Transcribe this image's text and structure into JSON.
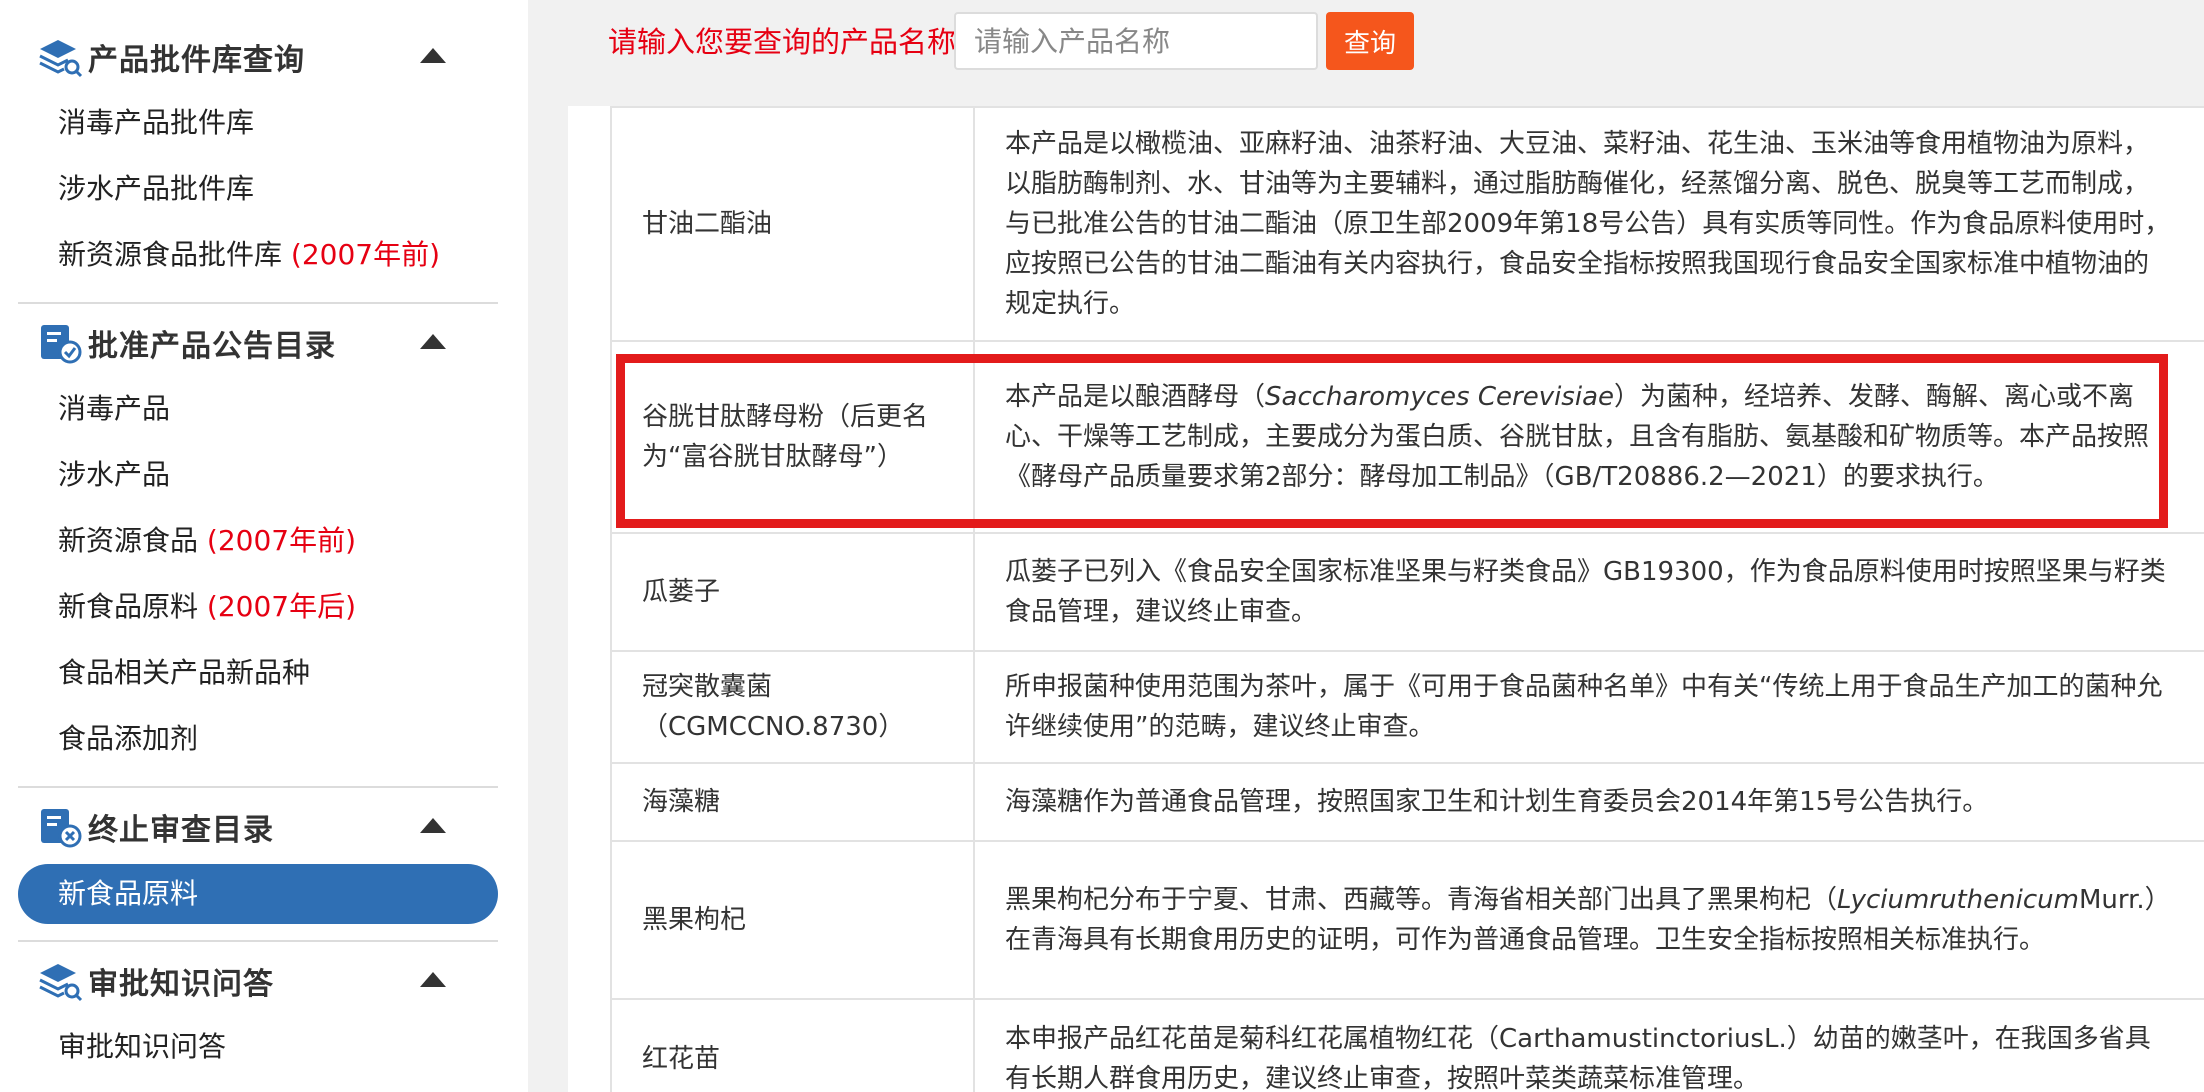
{
  "sidebar": {
    "sections": [
      {
        "title": "产品批件库查询",
        "icon": "layers-search-icon",
        "items": [
          "消毒产品批件库",
          "涉水产品批件库"
        ],
        "item_new_resource": {
          "label": "新资源食品批件库 ",
          "note": "(2007年前)"
        }
      },
      {
        "title": "批准产品公告目录",
        "icon": "approved-catalog-icon",
        "items": [
          "消毒产品",
          "涉水产品"
        ],
        "item_new_resource": {
          "label": "新资源食品 ",
          "note": "(2007年前)"
        },
        "item_new_food": {
          "label": "新食品原料 ",
          "note": "(2007年后)"
        },
        "items_more": [
          "食品相关产品新品种",
          "食品添加剂"
        ]
      },
      {
        "title": "终止审查目录",
        "icon": "terminated-catalog-icon",
        "active_item": "新食品原料"
      },
      {
        "title": "审批知识问答",
        "icon": "layers-search-icon",
        "items": [
          "审批知识问答"
        ]
      }
    ]
  },
  "search": {
    "label": "请输入您要查询的产品名称",
    "placeholder": "请输入产品名称",
    "value": "",
    "button_label": "查询"
  },
  "colors": {
    "accent_red": "#e60012",
    "active_blue": "#2f6fb4",
    "button_orange": "#f5561c",
    "highlight_box": "#e31b1b"
  },
  "table": {
    "rows": [
      {
        "name": "甘油二酯油",
        "desc": "本产品是以橄榄油、亚麻籽油、油茶籽油、大豆油、菜籽油、花生油、玉米油等食用植物油为原料，以脂肪酶制剂、水、甘油等为主要辅料，通过脂肪酶催化，经蒸馏分离、脱色、脱臭等工艺而制成，与已批准公告的甘油二酯油（原卫生部2009年第18号公告）具有实质等同性。作为食品原料使用时，应按照已公告的甘油二酯油有关内容执行，食品安全指标按照我国现行食品安全国家标准中植物油的规定执行。"
      },
      {
        "name": "谷胱甘肽酵母粉（后更名为“富谷胱甘肽酵母”）",
        "desc_before": "本产品是以酿酒酵母（",
        "desc_italic": "Saccharomyces Cerevisiae",
        "desc_after": "）为菌种，经培养、发酵、酶解、离心或不离心、干燥等工艺制成，主要成分为蛋白质、谷胱甘肽，且含有脂肪、氨基酸和矿物质等。本产品按照《酵母产品质量要求第2部分：酵母加工制品》（GB/T20886.2—2021）的要求执行。"
      },
      {
        "name": "瓜蒌子",
        "desc": "瓜蒌子已列入《食品安全国家标准坚果与籽类食品》GB19300，作为食品原料使用时按照坚果与籽类食品管理，建议终止审查。"
      },
      {
        "name": "冠突散囊菌（CGMCCNO.8730）",
        "desc": "所申报菌种使用范围为茶叶，属于《可用于食品菌种名单》中有关“传统上用于食品生产加工的菌种允许继续使用”的范畴，建议终止审查。"
      },
      {
        "name": "海藻糖",
        "desc": "海藻糖作为普通食品管理，按照国家卫生和计划生育委员会2014年第15号公告执行。"
      },
      {
        "name": "黑果枸杞",
        "desc_before": "黑果枸杞分布于宁夏、甘肃、西藏等。青海省相关部门出具了黑果枸杞（",
        "desc_italic": "Lyciumruthenicum",
        "desc_after": "Murr.）在青海具有长期食用历史的证明，可作为普通食品管理。卫生安全指标按照相关标准执行。"
      },
      {
        "name": "红花苗",
        "desc": "本申报产品红花苗是菊科红花属植物红花（CarthamustinctoriusL.）幼苗的嫩茎叶，在我国多省具有长期人群食用历史，建议终止审查，按照叶菜类蔬菜标准管理。"
      }
    ]
  }
}
